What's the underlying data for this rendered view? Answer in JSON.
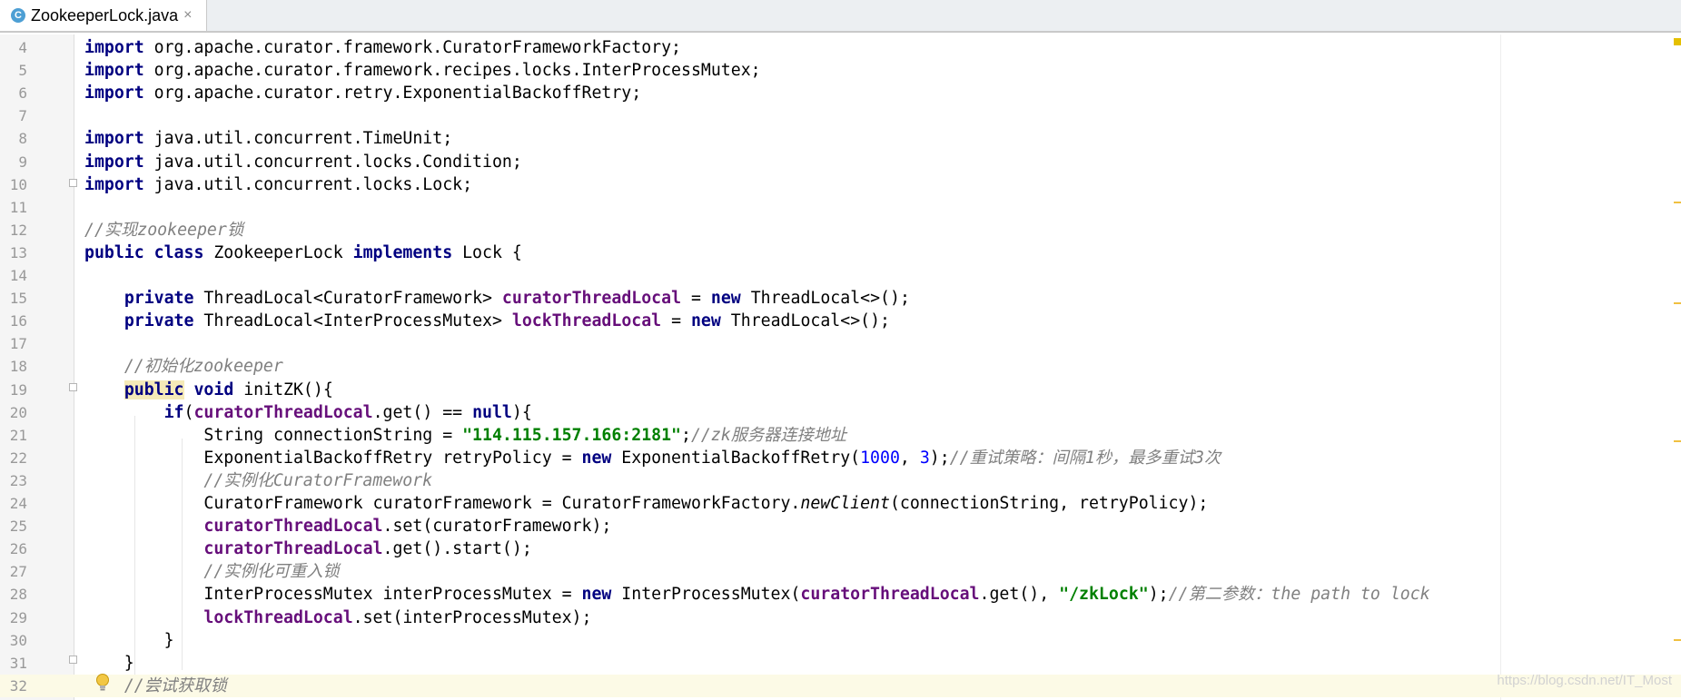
{
  "tab": {
    "filename": "ZookeeperLock.java",
    "icon_letter": "C",
    "close_glyph": "×"
  },
  "lines": [
    {
      "n": "4",
      "parts": [
        {
          "c": "kw",
          "t": "import"
        },
        {
          "c": "",
          "t": " org.apache.curator.framework.CuratorFrameworkFactory;"
        }
      ]
    },
    {
      "n": "5",
      "parts": [
        {
          "c": "kw",
          "t": "import"
        },
        {
          "c": "",
          "t": " org.apache.curator.framework.recipes.locks.InterProcessMutex;"
        }
      ]
    },
    {
      "n": "6",
      "parts": [
        {
          "c": "kw",
          "t": "import"
        },
        {
          "c": "",
          "t": " org.apache.curator.retry.ExponentialBackoffRetry;"
        }
      ]
    },
    {
      "n": "7",
      "parts": []
    },
    {
      "n": "8",
      "parts": [
        {
          "c": "kw",
          "t": "import"
        },
        {
          "c": "",
          "t": " java.util.concurrent.TimeUnit;"
        }
      ]
    },
    {
      "n": "9",
      "parts": [
        {
          "c": "kw",
          "t": "import"
        },
        {
          "c": "",
          "t": " java.util.concurrent.locks.Condition;"
        }
      ]
    },
    {
      "n": "10",
      "parts": [
        {
          "c": "kw",
          "t": "import"
        },
        {
          "c": "",
          "t": " java.util.concurrent.locks.Lock;"
        }
      ]
    },
    {
      "n": "11",
      "parts": []
    },
    {
      "n": "12",
      "parts": [
        {
          "c": "cmt",
          "t": "//实现zookeeper锁"
        }
      ]
    },
    {
      "n": "13",
      "parts": [
        {
          "c": "kw",
          "t": "public class"
        },
        {
          "c": "",
          "t": " ZookeeperLock "
        },
        {
          "c": "kw",
          "t": "implements"
        },
        {
          "c": "",
          "t": " Lock {"
        }
      ]
    },
    {
      "n": "14",
      "parts": []
    },
    {
      "n": "15",
      "parts": [
        {
          "c": "",
          "t": "    "
        },
        {
          "c": "kw",
          "t": "private"
        },
        {
          "c": "",
          "t": " ThreadLocal<CuratorFramework> "
        },
        {
          "c": "fld",
          "t": "curatorThreadLocal"
        },
        {
          "c": "",
          "t": " = "
        },
        {
          "c": "kw",
          "t": "new"
        },
        {
          "c": "",
          "t": " ThreadLocal<>();"
        }
      ]
    },
    {
      "n": "16",
      "parts": [
        {
          "c": "",
          "t": "    "
        },
        {
          "c": "kw",
          "t": "private"
        },
        {
          "c": "",
          "t": " ThreadLocal<InterProcessMutex> "
        },
        {
          "c": "fld",
          "t": "lockThreadLocal"
        },
        {
          "c": "",
          "t": " = "
        },
        {
          "c": "kw",
          "t": "new"
        },
        {
          "c": "",
          "t": " ThreadLocal<>();"
        }
      ]
    },
    {
      "n": "17",
      "parts": []
    },
    {
      "n": "18",
      "parts": [
        {
          "c": "",
          "t": "    "
        },
        {
          "c": "cmt",
          "t": "//初始化zookeeper"
        }
      ]
    },
    {
      "n": "19",
      "parts": [
        {
          "c": "",
          "t": "    "
        },
        {
          "c": "kw-hl",
          "t": "public"
        },
        {
          "c": "",
          "t": " "
        },
        {
          "c": "kw",
          "t": "void"
        },
        {
          "c": "",
          "t": " initZK(){"
        }
      ]
    },
    {
      "n": "20",
      "parts": [
        {
          "c": "",
          "t": "        "
        },
        {
          "c": "kw",
          "t": "if"
        },
        {
          "c": "",
          "t": "("
        },
        {
          "c": "fld",
          "t": "curatorThreadLocal"
        },
        {
          "c": "",
          "t": ".get() == "
        },
        {
          "c": "kw",
          "t": "null"
        },
        {
          "c": "",
          "t": "){"
        }
      ]
    },
    {
      "n": "21",
      "parts": [
        {
          "c": "",
          "t": "            String connectionString = "
        },
        {
          "c": "str",
          "t": "\"114.115.157.166:2181\""
        },
        {
          "c": "",
          "t": ";"
        },
        {
          "c": "cmt",
          "t": "//zk服务器连接地址"
        }
      ]
    },
    {
      "n": "22",
      "parts": [
        {
          "c": "",
          "t": "            ExponentialBackoffRetry retryPolicy = "
        },
        {
          "c": "kw",
          "t": "new"
        },
        {
          "c": "",
          "t": " ExponentialBackoffRetry("
        },
        {
          "c": "num",
          "t": "1000"
        },
        {
          "c": "",
          "t": ", "
        },
        {
          "c": "num",
          "t": "3"
        },
        {
          "c": "",
          "t": ");"
        },
        {
          "c": "cmt",
          "t": "//重试策略：间隔1秒，最多重试3次"
        }
      ]
    },
    {
      "n": "23",
      "parts": [
        {
          "c": "",
          "t": "            "
        },
        {
          "c": "cmt",
          "t": "//实例化CuratorFramework"
        }
      ]
    },
    {
      "n": "24",
      "parts": [
        {
          "c": "",
          "t": "            CuratorFramework curatorFramework = CuratorFrameworkFactory."
        },
        {
          "c": "ital",
          "t": "newClient"
        },
        {
          "c": "",
          "t": "(connectionString, retryPolicy);"
        }
      ]
    },
    {
      "n": "25",
      "parts": [
        {
          "c": "",
          "t": "            "
        },
        {
          "c": "fld",
          "t": "curatorThreadLocal"
        },
        {
          "c": "",
          "t": ".set(curatorFramework);"
        }
      ]
    },
    {
      "n": "26",
      "parts": [
        {
          "c": "",
          "t": "            "
        },
        {
          "c": "fld",
          "t": "curatorThreadLocal"
        },
        {
          "c": "",
          "t": ".get().start();"
        }
      ]
    },
    {
      "n": "27",
      "parts": [
        {
          "c": "",
          "t": "            "
        },
        {
          "c": "cmt",
          "t": "//实例化可重入锁"
        }
      ]
    },
    {
      "n": "28",
      "parts": [
        {
          "c": "",
          "t": "            InterProcessMutex interProcessMutex = "
        },
        {
          "c": "kw",
          "t": "new"
        },
        {
          "c": "",
          "t": " InterProcessMutex("
        },
        {
          "c": "fld",
          "t": "curatorThreadLocal"
        },
        {
          "c": "",
          "t": ".get(), "
        },
        {
          "c": "str",
          "t": "\"/zkLock\""
        },
        {
          "c": "",
          "t": ");"
        },
        {
          "c": "cmt",
          "t": "//第二参数：the path to lock"
        }
      ]
    },
    {
      "n": "29",
      "parts": [
        {
          "c": "",
          "t": "            "
        },
        {
          "c": "fld",
          "t": "lockThreadLocal"
        },
        {
          "c": "",
          "t": ".set(interProcessMutex);"
        }
      ]
    },
    {
      "n": "30",
      "parts": [
        {
          "c": "",
          "t": "        }"
        }
      ]
    },
    {
      "n": "31",
      "parts": [
        {
          "c": "",
          "t": "    }"
        }
      ]
    },
    {
      "n": "32",
      "parts": [
        {
          "c": "",
          "t": "    "
        },
        {
          "c": "cmt",
          "t": "//尝试获取锁"
        }
      ],
      "current": true
    }
  ],
  "watermark": "https://blog.csdn.net/IT_Most"
}
